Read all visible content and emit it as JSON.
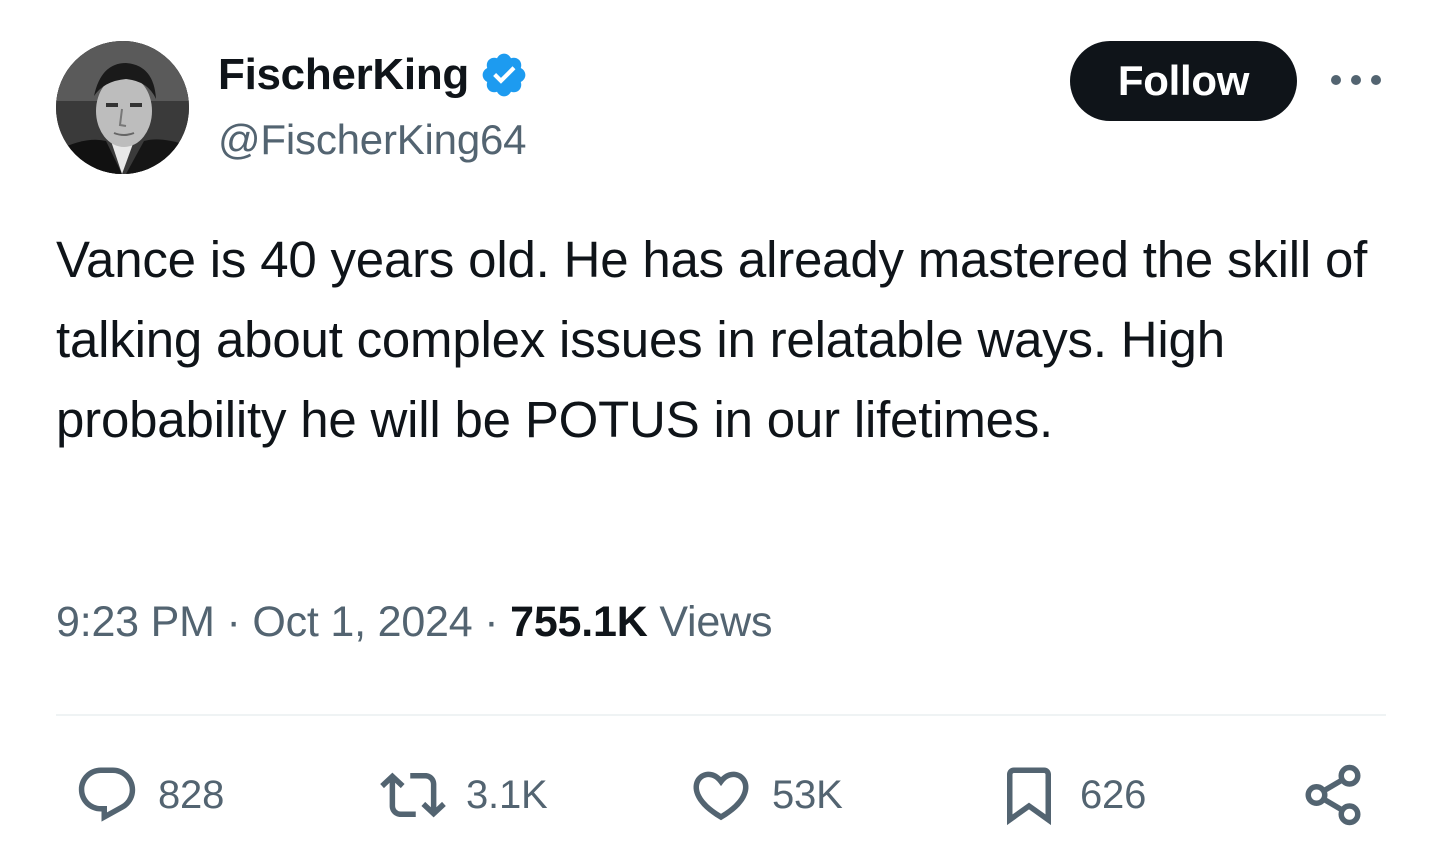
{
  "user": {
    "display_name": "FischerKing",
    "handle": "@FischerKing64",
    "verified_icon": "verified-badge-icon",
    "brand_blue": "#1d9bf0"
  },
  "follow_button": {
    "label": "Follow"
  },
  "more_button": {
    "icon": "more-dots-icon"
  },
  "tweet": {
    "text": "Vance is 40 years old. He has already mastered the skill of talking about complex issues in relatable ways. High probability he will be POTUS in our lifetimes."
  },
  "meta": {
    "time": "9:23 PM",
    "separator": "·",
    "date": "Oct 1, 2024",
    "views_count": "755.1K",
    "views_label": "Views"
  },
  "actions": {
    "reply": {
      "icon": "reply-icon",
      "count": "828"
    },
    "repost": {
      "icon": "repost-icon",
      "count": "3.1K"
    },
    "like": {
      "icon": "heart-icon",
      "count": "53K"
    },
    "bookmark": {
      "icon": "bookmark-icon",
      "count": "626"
    },
    "share": {
      "icon": "share-icon"
    }
  },
  "colors": {
    "text_primary": "#0f1419",
    "text_secondary": "#536471",
    "divider": "#eff3f4",
    "button_bg": "#0f1419"
  }
}
